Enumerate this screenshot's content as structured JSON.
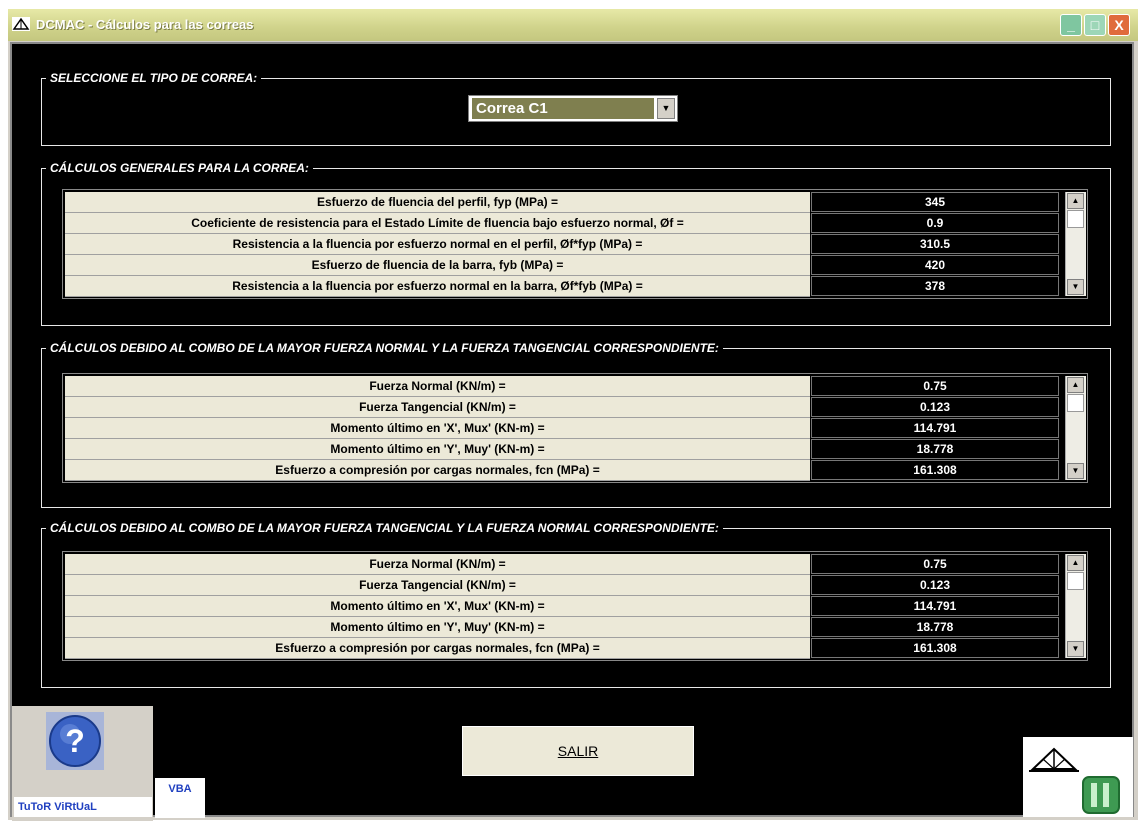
{
  "window": {
    "title": "DCMAC - Cálculos para las correas",
    "controls": {
      "minimize": "_",
      "maximize": "□",
      "close": "X"
    }
  },
  "selector": {
    "group_title": "SELECCIONE EL TIPO DE CORREA:",
    "value": "Correa C1"
  },
  "general": {
    "group_title": "CÁLCULOS GENERALES PARA LA CORREA:",
    "rows": [
      {
        "label": "Esfuerzo de fluencia del perfil, fyp (MPa) =",
        "value": "345"
      },
      {
        "label": "Coeficiente de resistencia para el Estado Límite de fluencia bajo esfuerzo normal, Øf =",
        "value": "0.9"
      },
      {
        "label": "Resistencia a la fluencia por esfuerzo normal en el perfil, Øf*fyp (MPa) =",
        "value": "310.5"
      },
      {
        "label": "Esfuerzo de fluencia de la barra, fyb (MPa) =",
        "value": "420"
      },
      {
        "label": "Resistencia a la fluencia por esfuerzo normal en la barra, Øf*fyb (MPa) =",
        "value": "378"
      }
    ]
  },
  "normal_combo": {
    "group_title": "CÁLCULOS DEBIDO AL COMBO DE LA MAYOR FUERZA NORMAL Y LA FUERZA TANGENCIAL CORRESPONDIENTE:",
    "rows": [
      {
        "label": "Fuerza Normal (KN/m) =",
        "value": "0.75"
      },
      {
        "label": "Fuerza Tangencial (KN/m) =",
        "value": "0.123"
      },
      {
        "label": "Momento último en 'X', Mux' (KN-m) =",
        "value": "114.791"
      },
      {
        "label": "Momento último en 'Y', Muy' (KN-m) =",
        "value": "18.778"
      },
      {
        "label": "Esfuerzo a compresión por cargas normales, fcn (MPa) =",
        "value": "161.308"
      }
    ]
  },
  "tangential_combo": {
    "group_title": "CÁLCULOS DEBIDO AL COMBO DE LA MAYOR FUERZA TANGENCIAL Y LA FUERZA NORMAL CORRESPONDIENTE:",
    "rows": [
      {
        "label": "Fuerza Normal (KN/m) =",
        "value": "0.75"
      },
      {
        "label": "Fuerza Tangencial (KN/m) =",
        "value": "0.123"
      },
      {
        "label": "Momento último en 'X', Mux' (KN-m) =",
        "value": "114.791"
      },
      {
        "label": "Momento último en 'Y', Muy' (KN-m) =",
        "value": "18.778"
      },
      {
        "label": "Esfuerzo a compresión por cargas normales, fcn (MPa) =",
        "value": "161.308"
      }
    ]
  },
  "footer": {
    "salir_label": "SALIR",
    "tutor_label": "TuToR ViRtUaL",
    "vba_label": "VBA"
  }
}
